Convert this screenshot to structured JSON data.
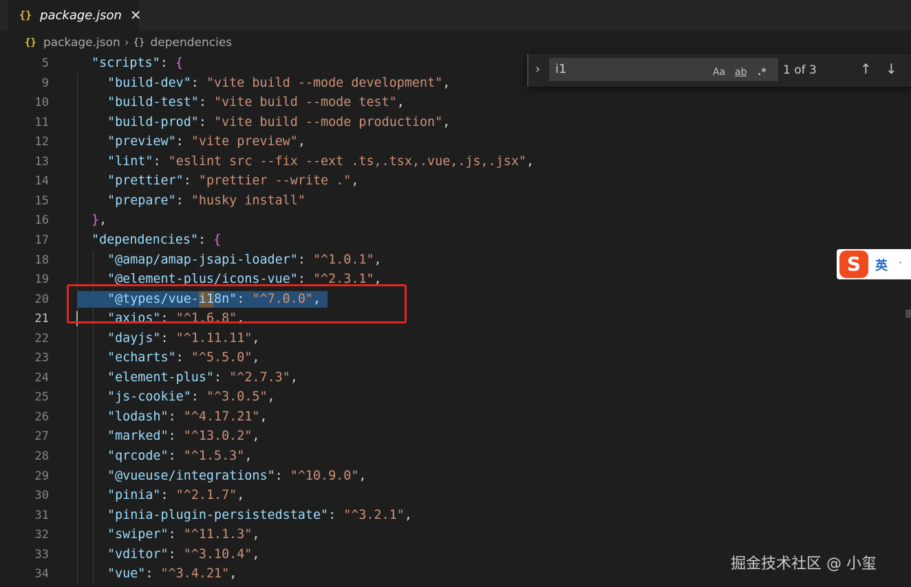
{
  "tab": {
    "icon": "{}",
    "title": "package.json",
    "close": "✕"
  },
  "breadcrumb": {
    "file_icon": "{}",
    "file": "package.json",
    "separator": "›",
    "node_icon": "{}",
    "node": "dependencies"
  },
  "find": {
    "toggle": "›",
    "query": "i1",
    "match_case": "Aa",
    "whole_word": "ab",
    "regex": ".*",
    "count": "1 of 3",
    "prev": "↑",
    "next": "↓",
    "close": "✕"
  },
  "ime": {
    "logo": "S",
    "lang": "英",
    "dot": "·"
  },
  "watermark": "掘金技术社区 @ 小玺",
  "lines": [
    {
      "n": "5",
      "indent": 1,
      "key": "\"scripts\"",
      "val": "",
      "tail": ": {",
      "tail_bracket": true
    },
    {
      "n": "9",
      "indent": 2,
      "key": "\"build-dev\"",
      "val": "\"vite build --mode development\"",
      "tail": ","
    },
    {
      "n": "10",
      "indent": 2,
      "key": "\"build-test\"",
      "val": "\"vite build --mode test\"",
      "tail": ","
    },
    {
      "n": "11",
      "indent": 2,
      "key": "\"build-prod\"",
      "val": "\"vite build --mode production\"",
      "tail": ","
    },
    {
      "n": "12",
      "indent": 2,
      "key": "\"preview\"",
      "val": "\"vite preview\"",
      "tail": ","
    },
    {
      "n": "13",
      "indent": 2,
      "key": "\"lint\"",
      "val": "\"eslint src --fix --ext .ts,.tsx,.vue,.js,.jsx\"",
      "tail": ","
    },
    {
      "n": "14",
      "indent": 2,
      "key": "\"prettier\"",
      "val": "\"prettier --write .\"",
      "tail": ","
    },
    {
      "n": "15",
      "indent": 2,
      "key": "\"prepare\"",
      "val": "\"husky install\"",
      "tail": ""
    },
    {
      "n": "16",
      "indent": 1,
      "key": "",
      "val": "",
      "tail": "},",
      "tail_bracket": true
    },
    {
      "n": "17",
      "indent": 1,
      "key": "\"dependencies\"",
      "val": "",
      "tail": ": {",
      "tail_bracket": true
    },
    {
      "n": "18",
      "indent": 2,
      "key": "\"@amap/amap-jsapi-loader\"",
      "val": "\"^1.0.1\"",
      "tail": ","
    },
    {
      "n": "19",
      "indent": 2,
      "key": "\"@element-plus/icons-vue\"",
      "val": "\"^2.3.1\"",
      "tail": ","
    },
    {
      "n": "20",
      "indent": 2,
      "key": "\"@types/vue-i18n\"",
      "val": "\"^7.0.0\"",
      "tail": ",",
      "selected": true
    },
    {
      "n": "21",
      "indent": 2,
      "key": "\"axios\"",
      "val": "\"^1.6.8\"",
      "tail": ",",
      "active": true
    },
    {
      "n": "22",
      "indent": 2,
      "key": "\"dayjs\"",
      "val": "\"^1.11.11\"",
      "tail": ","
    },
    {
      "n": "23",
      "indent": 2,
      "key": "\"echarts\"",
      "val": "\"^5.5.0\"",
      "tail": ","
    },
    {
      "n": "24",
      "indent": 2,
      "key": "\"element-plus\"",
      "val": "\"^2.7.3\"",
      "tail": ","
    },
    {
      "n": "25",
      "indent": 2,
      "key": "\"js-cookie\"",
      "val": "\"^3.0.5\"",
      "tail": ","
    },
    {
      "n": "26",
      "indent": 2,
      "key": "\"lodash\"",
      "val": "\"^4.17.21\"",
      "tail": ","
    },
    {
      "n": "27",
      "indent": 2,
      "key": "\"marked\"",
      "val": "\"^13.0.2\"",
      "tail": ","
    },
    {
      "n": "28",
      "indent": 2,
      "key": "\"qrcode\"",
      "val": "\"^1.5.3\"",
      "tail": ","
    },
    {
      "n": "29",
      "indent": 2,
      "key": "\"@vueuse/integrations\"",
      "val": "\"^10.9.0\"",
      "tail": ","
    },
    {
      "n": "30",
      "indent": 2,
      "key": "\"pinia\"",
      "val": "\"^2.1.7\"",
      "tail": ","
    },
    {
      "n": "31",
      "indent": 2,
      "key": "\"pinia-plugin-persistedstate\"",
      "val": "\"^3.2.1\"",
      "tail": ","
    },
    {
      "n": "32",
      "indent": 2,
      "key": "\"swiper\"",
      "val": "\"^11.1.3\"",
      "tail": ","
    },
    {
      "n": "33",
      "indent": 2,
      "key": "\"vditor\"",
      "val": "\"^3.10.4\"",
      "tail": ","
    },
    {
      "n": "34",
      "indent": 2,
      "key": "\"vue\"",
      "val": "\"^3.4.21\"",
      "tail": ","
    }
  ],
  "colors": {
    "key": "#9cdcfe",
    "string": "#ce9178",
    "bracket": "#da70d6",
    "selection": "#264f78",
    "annotation": "#e0261f"
  }
}
